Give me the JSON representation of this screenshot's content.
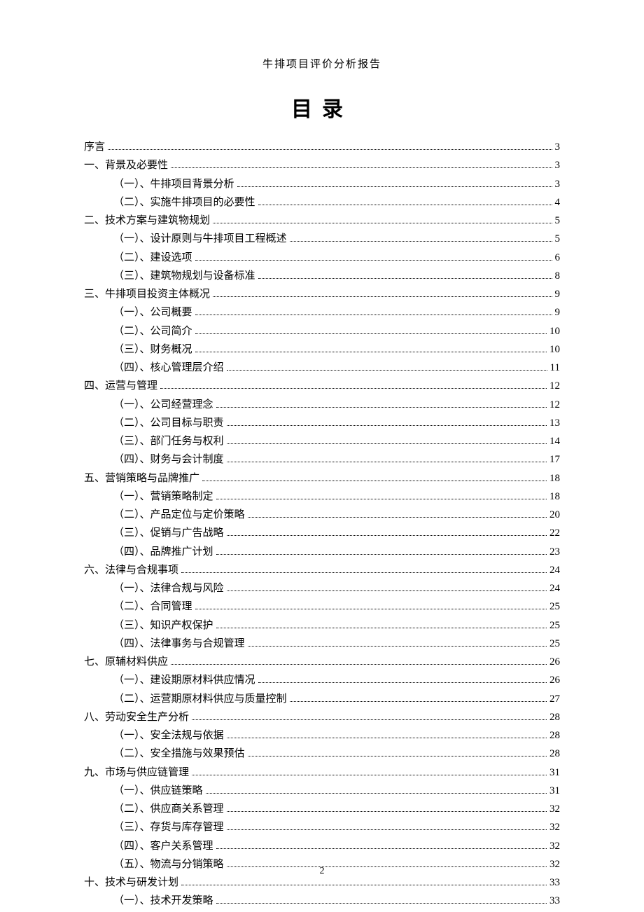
{
  "header": "牛排项目评价分析报告",
  "title": "目录",
  "pageNumber": "2",
  "toc": [
    {
      "level": 1,
      "label": "序言",
      "page": "3"
    },
    {
      "level": 1,
      "label": "一、背景及必要性",
      "page": "3"
    },
    {
      "level": 2,
      "label": "（一）、牛排项目背景分析",
      "page": "3"
    },
    {
      "level": 2,
      "label": "（二）、实施牛排项目的必要性",
      "page": "4"
    },
    {
      "level": 1,
      "label": "二、技术方案与建筑物规划",
      "page": "5"
    },
    {
      "level": 2,
      "label": "（一）、设计原则与牛排项目工程概述",
      "page": "5"
    },
    {
      "level": 2,
      "label": "（二）、建设选项",
      "page": "6"
    },
    {
      "level": 2,
      "label": "（三）、建筑物规划与设备标准",
      "page": "8"
    },
    {
      "level": 1,
      "label": "三、牛排项目投资主体概况",
      "page": "9"
    },
    {
      "level": 2,
      "label": "（一）、公司概要",
      "page": "9"
    },
    {
      "level": 2,
      "label": "（二）、公司简介",
      "page": "10"
    },
    {
      "level": 2,
      "label": "（三）、财务概况",
      "page": "10"
    },
    {
      "level": 2,
      "label": "（四）、核心管理层介绍",
      "page": "11"
    },
    {
      "level": 1,
      "label": "四、运营与管理",
      "page": "12"
    },
    {
      "level": 2,
      "label": "（一）、公司经营理念",
      "page": "12"
    },
    {
      "level": 2,
      "label": "（二）、公司目标与职责",
      "page": "13"
    },
    {
      "level": 2,
      "label": "（三）、部门任务与权利",
      "page": "14"
    },
    {
      "level": 2,
      "label": "（四）、财务与会计制度",
      "page": "17"
    },
    {
      "level": 1,
      "label": "五、营销策略与品牌推广",
      "page": "18"
    },
    {
      "level": 2,
      "label": "（一）、营销策略制定",
      "page": "18"
    },
    {
      "level": 2,
      "label": "（二）、产品定位与定价策略",
      "page": "20"
    },
    {
      "level": 2,
      "label": "（三）、促销与广告战略",
      "page": "22"
    },
    {
      "level": 2,
      "label": "（四）、品牌推广计划",
      "page": "23"
    },
    {
      "level": 1,
      "label": "六、法律与合规事项",
      "page": "24"
    },
    {
      "level": 2,
      "label": "（一）、法律合规与风险",
      "page": "24"
    },
    {
      "level": 2,
      "label": "（二）、合同管理",
      "page": "25"
    },
    {
      "level": 2,
      "label": "（三）、知识产权保护",
      "page": "25"
    },
    {
      "level": 2,
      "label": "（四）、法律事务与合规管理",
      "page": "25"
    },
    {
      "level": 1,
      "label": "七、原辅材料供应",
      "page": "26"
    },
    {
      "level": 2,
      "label": "（一）、建设期原材料供应情况",
      "page": "26"
    },
    {
      "level": 2,
      "label": "（二）、运营期原材料供应与质量控制",
      "page": "27"
    },
    {
      "level": 1,
      "label": "八、劳动安全生产分析",
      "page": "28"
    },
    {
      "level": 2,
      "label": "（一）、安全法规与依据",
      "page": "28"
    },
    {
      "level": 2,
      "label": "（二）、安全措施与效果预估",
      "page": "28"
    },
    {
      "level": 1,
      "label": "九、市场与供应链管理",
      "page": "31"
    },
    {
      "level": 2,
      "label": "（一）、供应链策略",
      "page": "31"
    },
    {
      "level": 2,
      "label": "（二）、供应商关系管理",
      "page": "32"
    },
    {
      "level": 2,
      "label": "（三）、存货与库存管理",
      "page": "32"
    },
    {
      "level": 2,
      "label": "（四）、客户关系管理",
      "page": "32"
    },
    {
      "level": 2,
      "label": "（五）、物流与分销策略",
      "page": "32"
    },
    {
      "level": 1,
      "label": "十、技术与研发计划",
      "page": "33"
    },
    {
      "level": 2,
      "label": "（一）、技术开发策略",
      "page": "33"
    }
  ]
}
